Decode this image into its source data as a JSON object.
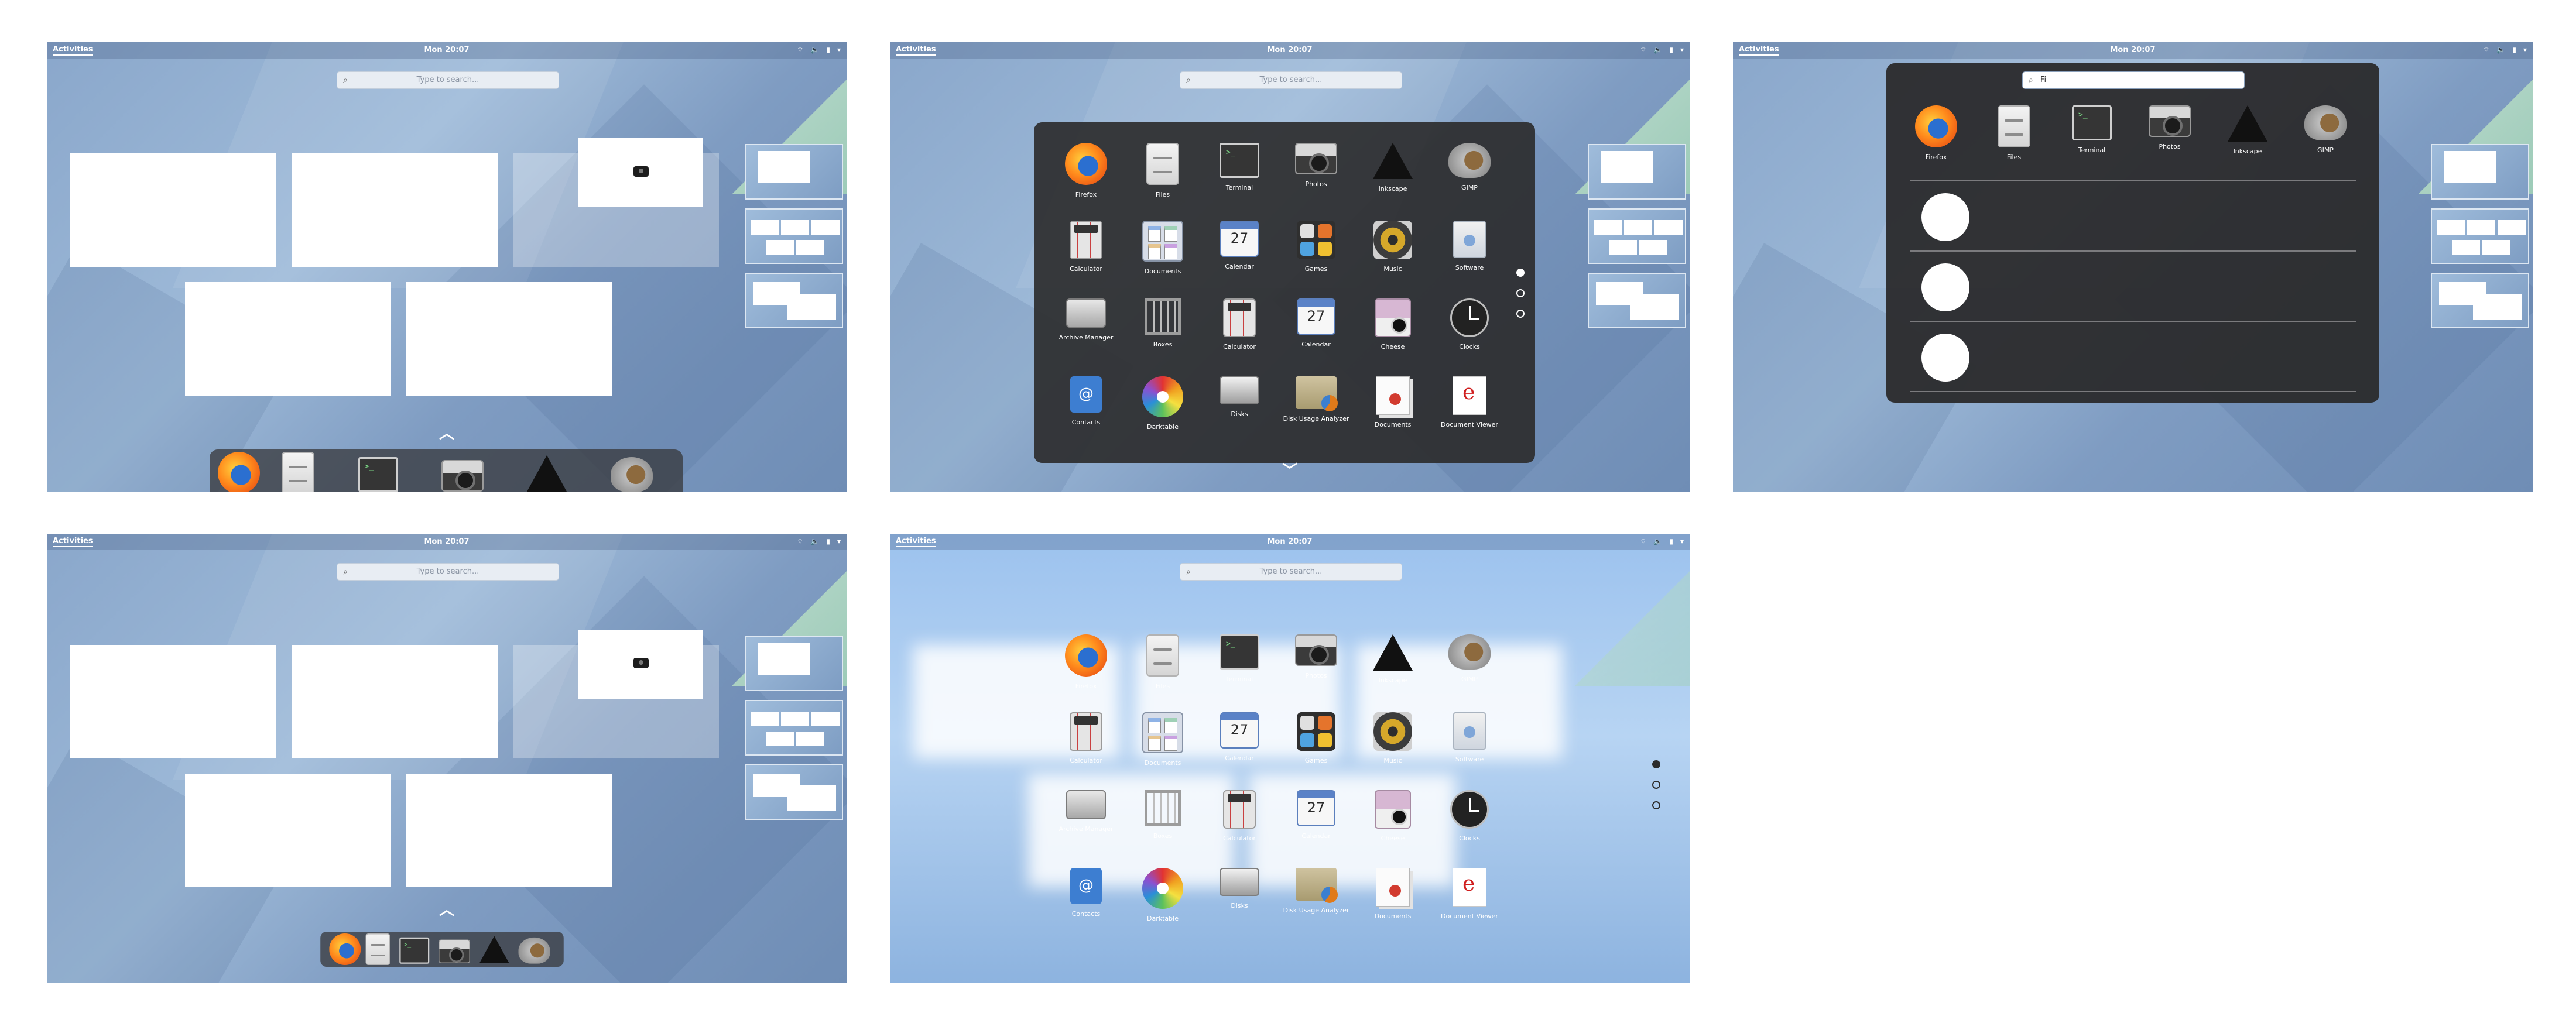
{
  "topbar": {
    "activities": "Activities",
    "clock": "Mon 20:07",
    "tray_icons": [
      "network-icon",
      "volume-icon",
      "battery-icon",
      "menu-caret-icon"
    ]
  },
  "search": {
    "placeholder": "Type to search...",
    "query": "Fi"
  },
  "apps": [
    {
      "name": "Firefox",
      "icon": "firefox-icon"
    },
    {
      "name": "Files",
      "icon": "files-icon"
    },
    {
      "name": "Terminal",
      "icon": "terminal-icon"
    },
    {
      "name": "Photos",
      "icon": "photos-icon"
    },
    {
      "name": "Inkscape",
      "icon": "inkscape-icon"
    },
    {
      "name": "GIMP",
      "icon": "gimp-icon"
    },
    {
      "name": "Calculator",
      "icon": "calculator-icon"
    },
    {
      "name": "Documents",
      "icon": "documents-folder-icon"
    },
    {
      "name": "Calendar",
      "icon": "calendar-icon"
    },
    {
      "name": "Games",
      "icon": "games-icon"
    },
    {
      "name": "Music",
      "icon": "music-icon"
    },
    {
      "name": "Software",
      "icon": "software-icon"
    },
    {
      "name": "Archive Manager",
      "icon": "archive-icon"
    },
    {
      "name": "Boxes",
      "icon": "boxes-icon"
    },
    {
      "name": "Calculator",
      "icon": "calculator-icon"
    },
    {
      "name": "Calendar",
      "icon": "calendar-icon"
    },
    {
      "name": "Cheese",
      "icon": "cheese-icon"
    },
    {
      "name": "Clocks",
      "icon": "clocks-icon"
    },
    {
      "name": "Contacts",
      "icon": "contacts-icon"
    },
    {
      "name": "Darktable",
      "icon": "darktable-icon"
    },
    {
      "name": "Disks",
      "icon": "disks-icon"
    },
    {
      "name": "Disk Usage Analyzer",
      "icon": "disk-usage-icon"
    },
    {
      "name": "Documents",
      "icon": "documents-icon"
    },
    {
      "name": "Document Viewer",
      "icon": "document-viewer-icon"
    }
  ],
  "calendar_day": "27",
  "contacts_symbol": "@",
  "app_grid": {
    "pages": 3,
    "current_page": 1
  },
  "colors": {
    "panel": "#2c2c2e",
    "wallpaper": "#8aa7cb",
    "accent_green": "#9fd0b6"
  }
}
